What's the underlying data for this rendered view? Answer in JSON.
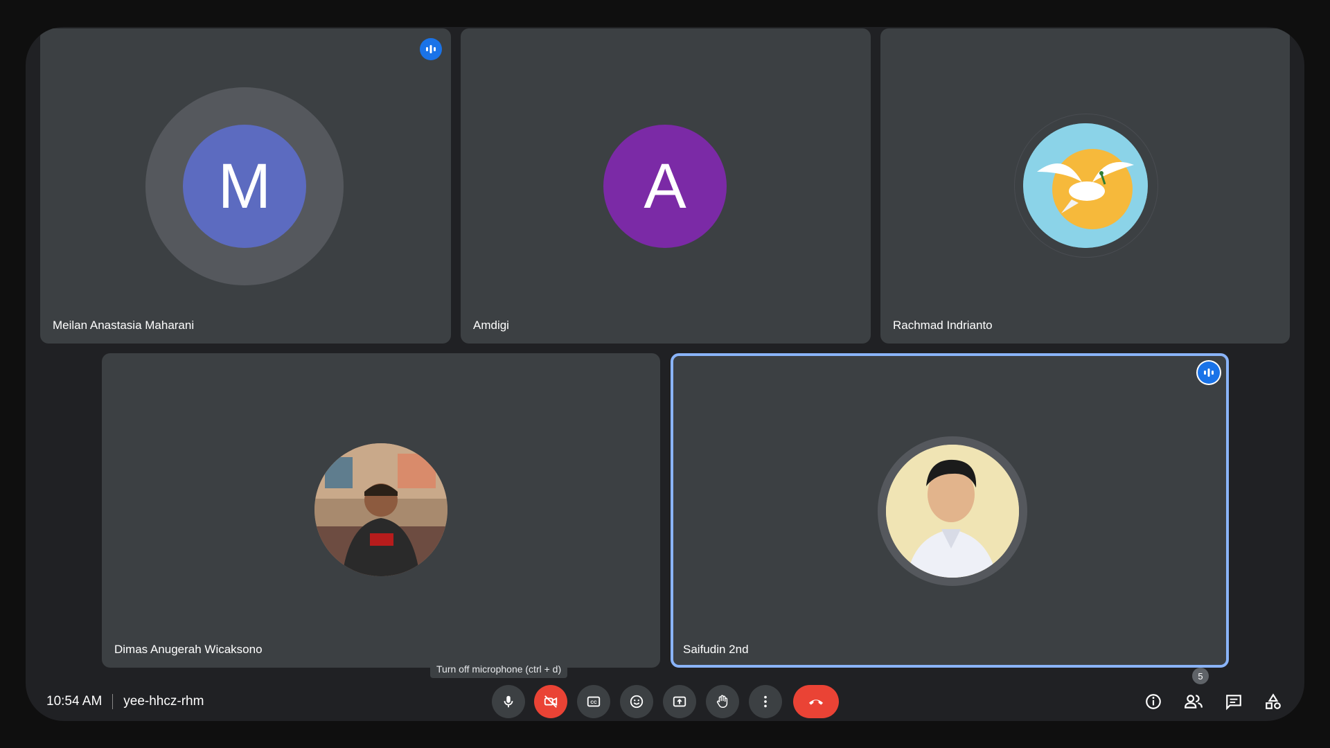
{
  "participants": [
    {
      "name": "Meilan Anastasia Maharani",
      "initial": "M",
      "color": "#5c6bc0",
      "speaking": true
    },
    {
      "name": "Amdigi",
      "initial": "A",
      "color": "#7b2aa6",
      "speaking": false
    },
    {
      "name": "Rachmad Indrianto",
      "initial": "",
      "speaking": false
    },
    {
      "name": "Dimas Anugerah Wicaksono",
      "initial": "",
      "speaking": false
    },
    {
      "name": "Saifudin 2nd",
      "initial": "",
      "speaking": true,
      "pinned_active": true
    }
  ],
  "meeting": {
    "time": "10:54 AM",
    "code": "yee-hhcz-rhm"
  },
  "tooltip": "Turn off microphone (ctrl + d)",
  "people_count": "5",
  "colors": {
    "accent": "#8ab4f8",
    "danger": "#ea4335",
    "tile": "#3c4043",
    "speaking": "#1a73e8"
  }
}
